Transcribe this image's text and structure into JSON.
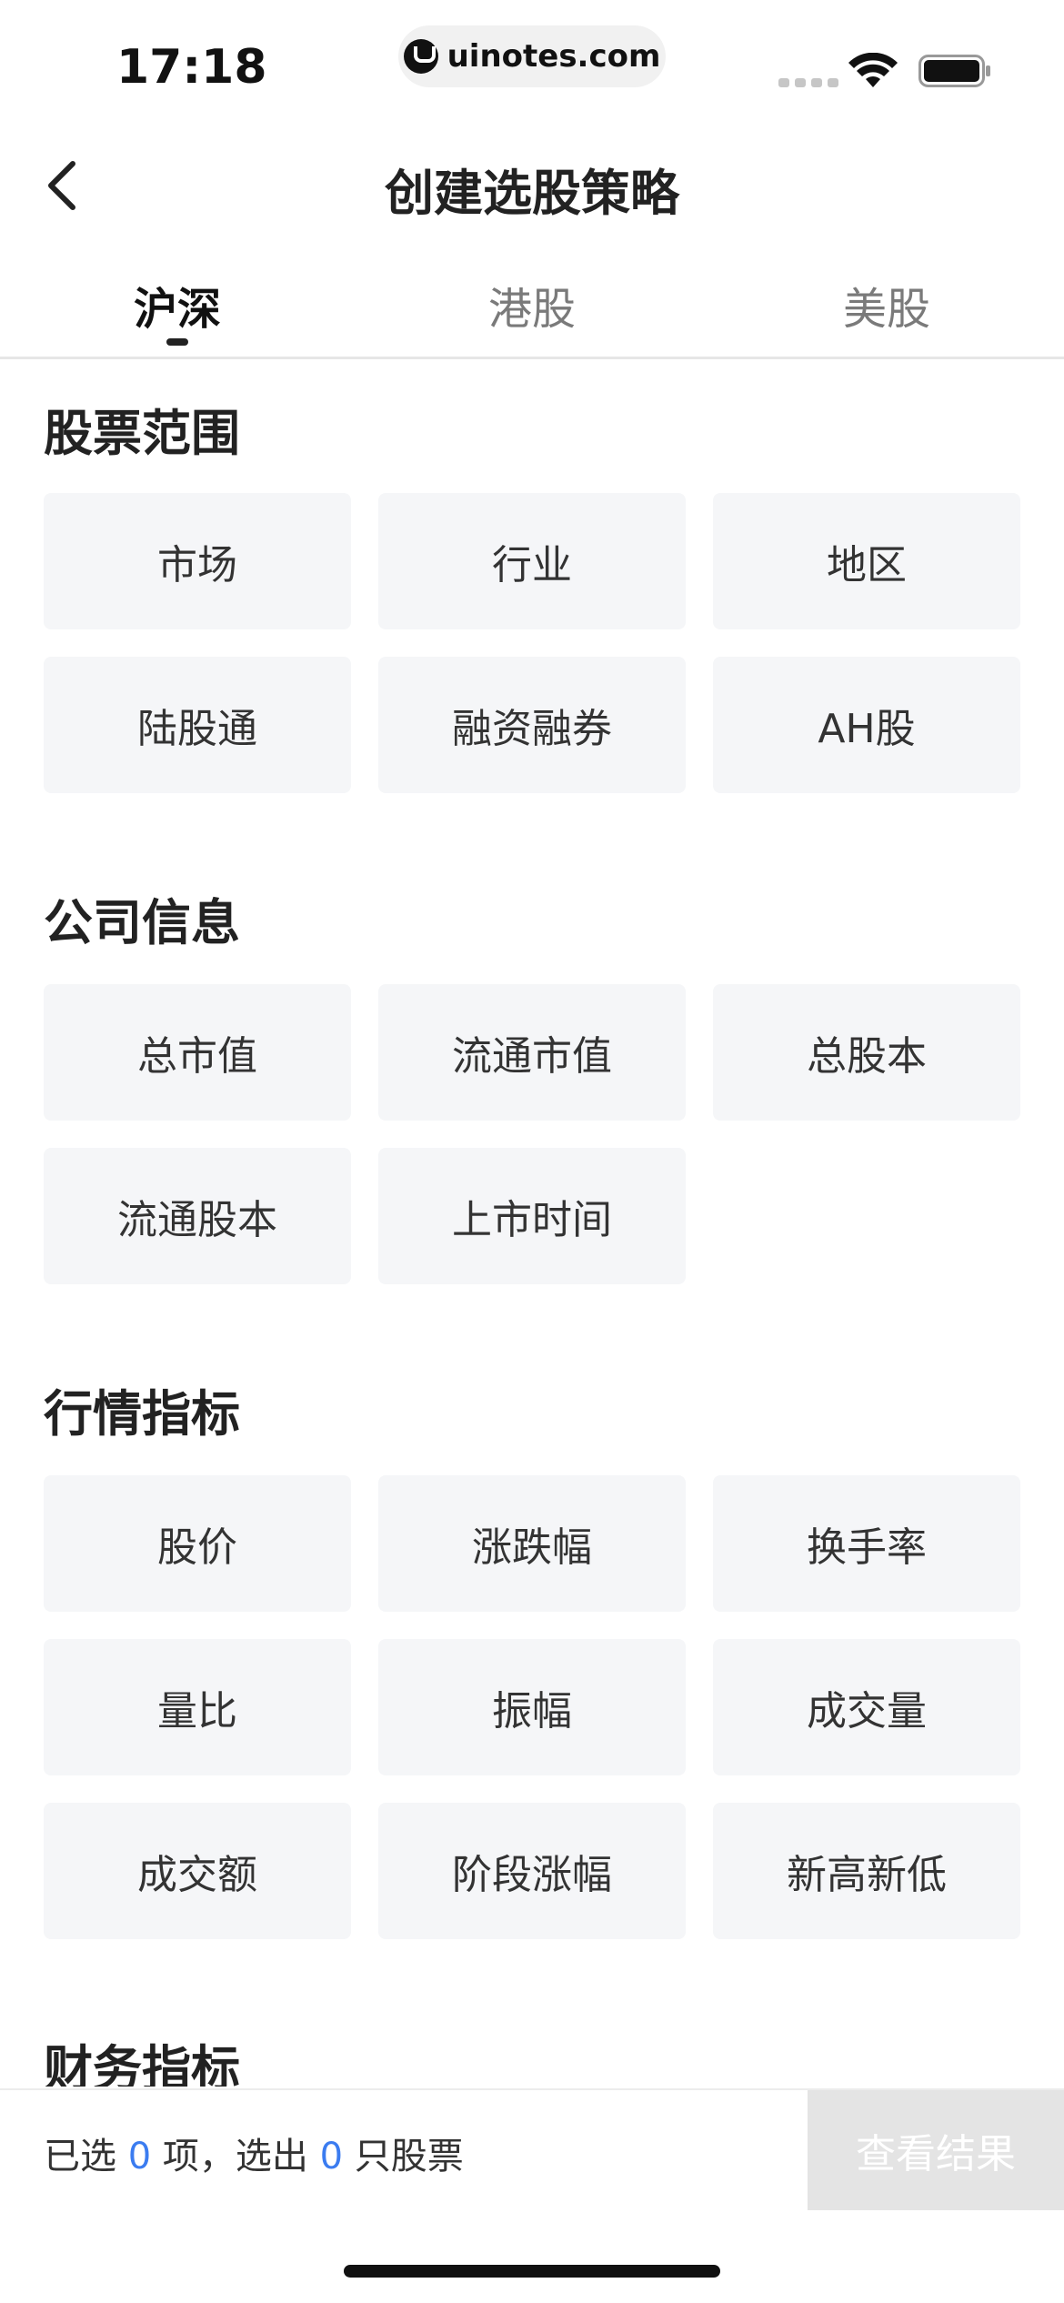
{
  "status_bar": {
    "time": "17:18",
    "url": "uinotes.com",
    "icons": [
      "signal-icon",
      "wifi-icon",
      "battery-icon"
    ]
  },
  "nav": {
    "title": "创建选股策略",
    "back_icon": "chevron-left-icon"
  },
  "tabs": [
    {
      "label": "沪深",
      "active": true
    },
    {
      "label": "港股",
      "active": false
    },
    {
      "label": "美股",
      "active": false
    }
  ],
  "sections": [
    {
      "title": "股票范围",
      "options": [
        "市场",
        "行业",
        "地区",
        "陆股通",
        "融资融券",
        "AH股"
      ]
    },
    {
      "title": "公司信息",
      "options": [
        "总市值",
        "流通市值",
        "总股本",
        "流通股本",
        "上市时间"
      ]
    },
    {
      "title": "行情指标",
      "options": [
        "股价",
        "涨跌幅",
        "换手率",
        "量比",
        "振幅",
        "成交量",
        "成交额",
        "阶段涨幅",
        "新高新低"
      ]
    },
    {
      "title": "财务指标",
      "options": []
    }
  ],
  "footer": {
    "prefix": "已选",
    "selected_count": "0",
    "middle": "项，选出",
    "result_count": "0",
    "suffix": "只股票",
    "button_label": "查看结果"
  },
  "colors": {
    "accent": "#3b7cf0",
    "option_bg": "#f5f6f8",
    "button_disabled_bg": "#e4e4e4"
  }
}
